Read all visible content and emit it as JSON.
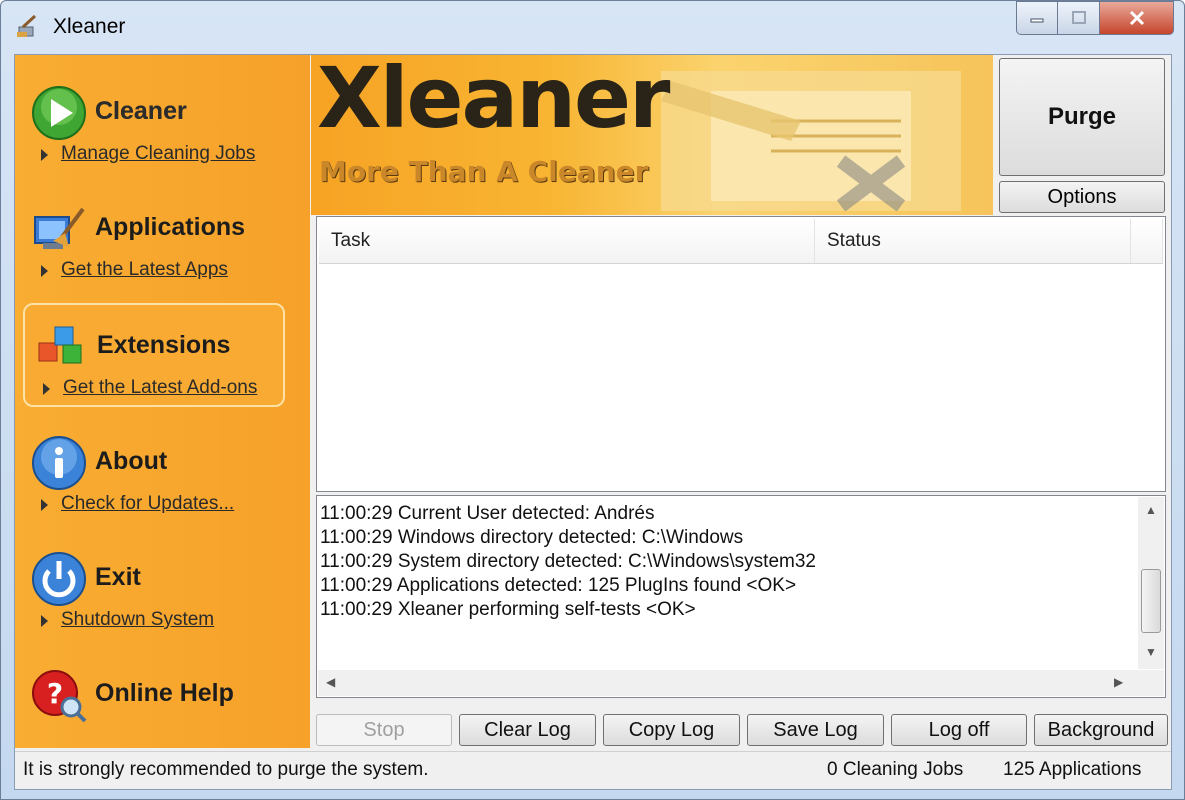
{
  "window": {
    "title": "Xleaner"
  },
  "sidebar": {
    "items": [
      {
        "title": "Cleaner",
        "link": "Manage Cleaning Jobs",
        "icon": "play-icon"
      },
      {
        "title": "Applications",
        "link": "Get the Latest Apps",
        "icon": "applications-icon"
      },
      {
        "title": "Extensions",
        "link": "Get the Latest Add-ons",
        "icon": "extensions-cubes-icon"
      },
      {
        "title": "About",
        "link": "Check for Updates...",
        "icon": "info-icon"
      },
      {
        "title": "Exit",
        "link": "Shutdown System",
        "icon": "power-icon"
      },
      {
        "title": "Online Help",
        "icon": "help-icon"
      }
    ]
  },
  "banner": {
    "logo": "Xleaner",
    "tagline": "More Than A Cleaner"
  },
  "actions": {
    "purge": "Purge",
    "options": "Options"
  },
  "task_list": {
    "columns": [
      "Task",
      "Status"
    ],
    "rows": []
  },
  "log": {
    "lines": [
      "11:00:29 Current User detected: Andrés",
      "11:00:29 Windows directory detected: C:\\Windows",
      "11:00:29 System directory detected: C:\\Windows\\system32",
      "11:00:29 Applications detected: 125 PlugIns found <OK>",
      "11:00:29 Xleaner performing self-tests <OK>"
    ]
  },
  "buttons": {
    "stop": "Stop",
    "clear_log": "Clear Log",
    "copy_log": "Copy Log",
    "save_log": "Save Log",
    "log_off": "Log off",
    "background": "Background"
  },
  "status": {
    "message": "It is strongly recommended to purge the system.",
    "jobs": "0 Cleaning Jobs",
    "applications": "125 Applications"
  },
  "colors": {
    "sidebar": "#f7a62a",
    "banner_text": "#2a2418",
    "close_button": "#c6452c"
  }
}
